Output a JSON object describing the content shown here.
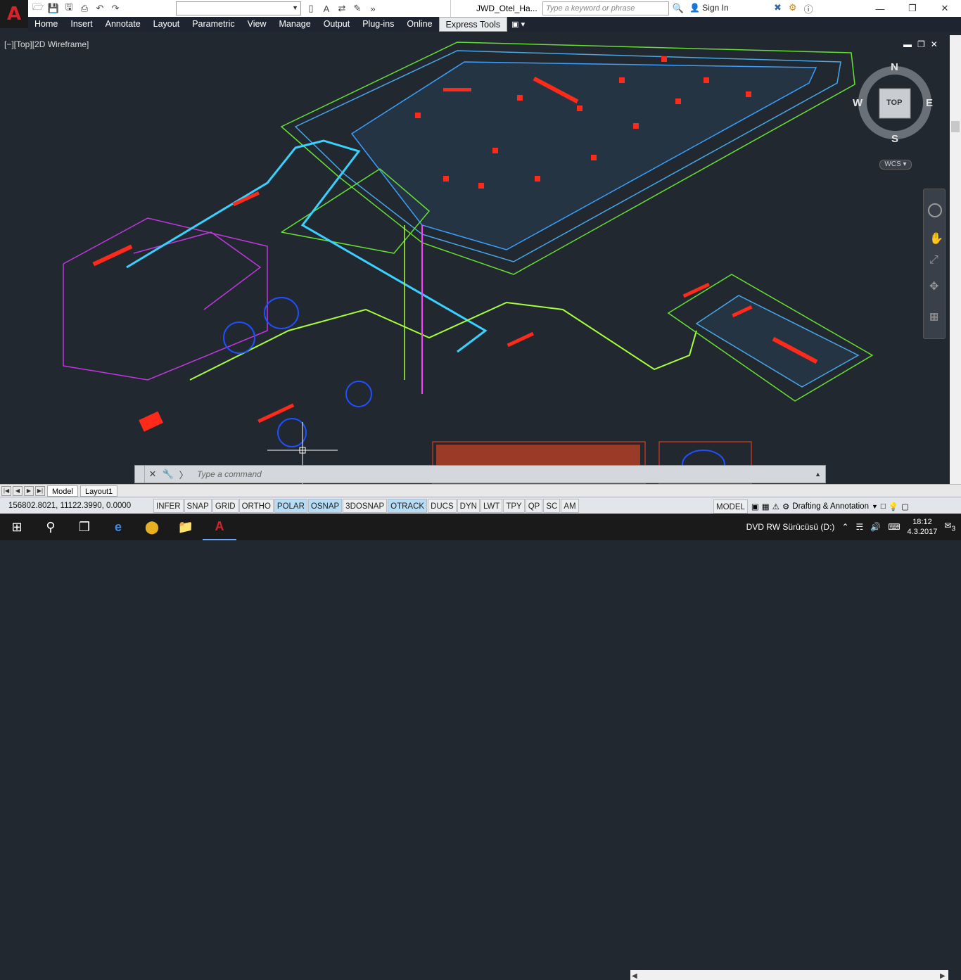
{
  "titlebar": {
    "doc_title": "JWD_Otel_Ha...",
    "search_placeholder": "Type a keyword or phrase",
    "signin": "Sign In"
  },
  "ribbon": {
    "tabs": [
      "Home",
      "Insert",
      "Annotate",
      "Layout",
      "Parametric",
      "View",
      "Manage",
      "Output",
      "Plug-ins",
      "Online",
      "Express Tools"
    ],
    "active_tab": "Express Tools"
  },
  "viewport": {
    "label": "[−][Top][2D Wireframe]",
    "viewcube": {
      "n": "N",
      "s": "S",
      "e": "E",
      "w": "W",
      "face": "TOP",
      "ucs": "WCS"
    }
  },
  "command": {
    "placeholder": "Type a command"
  },
  "layout_tabs": [
    "Model",
    "Layout1"
  ],
  "status": {
    "coords": "156802.8021, 11122.3990, 0.0000",
    "toggles": [
      {
        "label": "INFER",
        "on": false
      },
      {
        "label": "SNAP",
        "on": false
      },
      {
        "label": "GRID",
        "on": false
      },
      {
        "label": "ORTHO",
        "on": false
      },
      {
        "label": "POLAR",
        "on": true
      },
      {
        "label": "OSNAP",
        "on": true
      },
      {
        "label": "3DOSNAP",
        "on": false
      },
      {
        "label": "OTRACK",
        "on": true
      },
      {
        "label": "DUCS",
        "on": false
      },
      {
        "label": "DYN",
        "on": false
      },
      {
        "label": "LWT",
        "on": false
      },
      {
        "label": "TPY",
        "on": false
      },
      {
        "label": "QP",
        "on": false
      },
      {
        "label": "SC",
        "on": false
      },
      {
        "label": "AM",
        "on": false
      }
    ],
    "model": "MODEL",
    "workspace": "Drafting & Annotation"
  },
  "taskbar": {
    "drive": "DVD RW Sürücüsü (D:)",
    "time": "18:12",
    "date": "4.3.2017",
    "notif_count": "3"
  }
}
